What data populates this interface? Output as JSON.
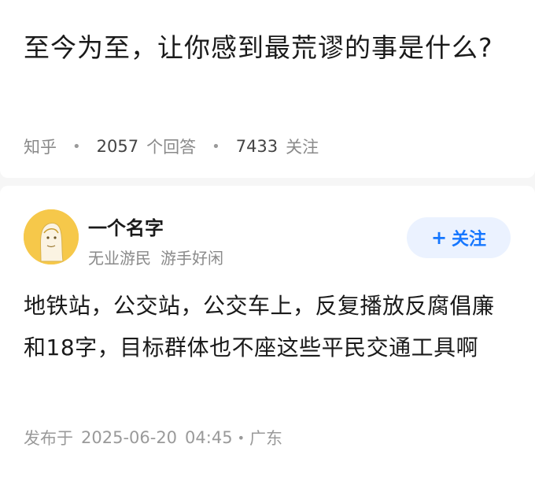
{
  "question": {
    "title": "至今为至，让你感到最荒谬的事是什么?",
    "source": "知乎",
    "answers_count": "2057",
    "answers_label": "个回答",
    "followers_count": "7433",
    "followers_label": "关注"
  },
  "answer": {
    "author_name": "一个名字",
    "author_tags": [
      "无业游民",
      "游手好闲"
    ],
    "follow_label": "关注",
    "follow_icon": "+",
    "content": "地铁站，公交站，公交车上，反复播放反腐倡廉和18字，目标群体也不座这些平民交通工具啊",
    "published_label": "发布于",
    "published_date": "2025-06-20",
    "published_time": "04:45",
    "location": "广东"
  },
  "colors": {
    "accent": "#1677ff",
    "follow_bg": "#ebf2ff",
    "avatar_bg": "#f6c84a",
    "text_main": "#1a1a1a",
    "text_muted": "#8a8a8a"
  }
}
